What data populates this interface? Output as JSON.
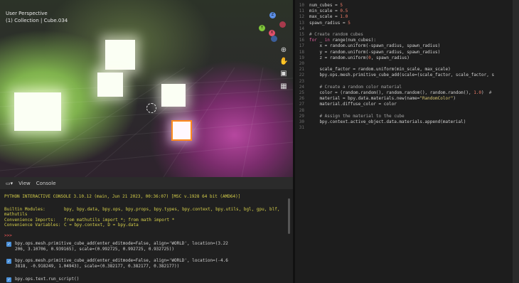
{
  "viewport": {
    "mode_label": "User Perspective",
    "collection_label": "(1) Collection | Cube.034",
    "gizmo": {
      "z": "Z",
      "y": "Y",
      "x": "X"
    }
  },
  "console": {
    "header": {
      "view": "View",
      "console": "Console"
    },
    "banner": "PYTHON INTERACTIVE CONSOLE 3.10.12 (main, Jun 21 2023, 00:36:07) [MSC v.1928 64 bit (AMD64)]",
    "builtin_label": "Builtin Modules:",
    "builtin_value": "bpy, bpy.data, bpy.ops, bpy.props, bpy.types, bpy.context, bpy.utils, bgl, gpu, blf,",
    "builtin_value2": "mathutils",
    "imports_label": "Convenience Imports:",
    "imports_value": "from mathutils import *; from math import *",
    "vars_label": "Convenience Variables:",
    "vars_value": "C = bpy.context, D = bpy.data",
    "prompt": ">>> ",
    "entry1_line1": "bpy.ops.mesh.primitive_cube_add(enter_editmode=False, align='WORLD', location=(3.22",
    "entry1_line2": "206, 3.10706, 0.939165), scale=(0.992725, 0.992725, 0.932725))",
    "entry2_line1": "bpy.ops.mesh.primitive_cube_add(enter_editmode=False, align='WORLD', location=(-4.6",
    "entry2_line2": "3818, -0.918249, 1.04943), scale=(0.382177, 0.382177, 0.382177))",
    "entry3": "bpy.ops.text.run_script()"
  },
  "editor": {
    "line_numbers": [
      "10",
      "11",
      "12",
      "13",
      "14",
      "15",
      "16",
      "17",
      "18",
      "19",
      "20",
      "21",
      "22",
      "23",
      "24",
      "25",
      "26",
      "27",
      "28",
      "29",
      "30",
      "31"
    ],
    "code_lines": [
      "num_cubes = 5",
      "min_scale = 0.5",
      "max_scale = 1.0",
      "spawn_radius = 5",
      "",
      "# Create random cubes",
      "for _ in range(num_cubes):",
      "    x = random.uniform(-spawn_radius, spawn_radius)",
      "    y = random.uniform(-spawn_radius, spawn_radius)",
      "    z = random.uniform(0, spawn_radius)",
      "",
      "    scale_factor = random.uniform(min_scale, max_scale)",
      "    bpy.ops.mesh.primitive_cube_add(scale=(scale_factor, scale_factor, s",
      "",
      "    # Create a random color material",
      "    color = (random.random(), random.random(), random.random(), 1.0)  #",
      "    material = bpy.data.materials.new(name=\"RandomColor\")",
      "    material.diffuse_color = color",
      "",
      "    # Assign the material to the cube",
      "    bpy.context.active_object.data.materials.append(material)",
      ""
    ]
  },
  "colors": {
    "accent": "#4a90d9",
    "selection": "#ff8a1c"
  }
}
